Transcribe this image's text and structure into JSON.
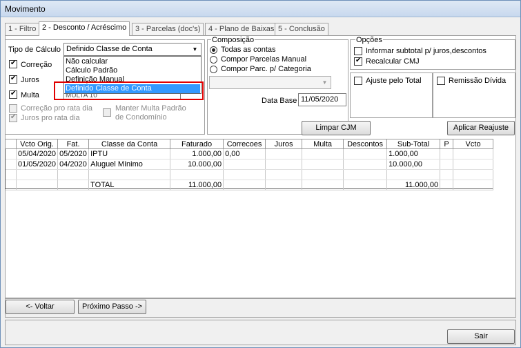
{
  "window": {
    "title": "Movimento"
  },
  "tabs": [
    "1 - Filtro",
    "2 - Desconto / Acréscimo",
    "3 - Parcelas (doc's)",
    "4 - Plano de Baixas",
    "5 - Conclusão"
  ],
  "calc": {
    "label": "Tipo de Cálculo",
    "value": "Definido Classe de Conta",
    "options": [
      "Não calcular",
      "Cálculo Padrão",
      "Definição Manual",
      "Definido Classe de Conta"
    ],
    "hidden_value": "MULTA 10"
  },
  "checks": {
    "correcao": "Correção",
    "juros": "Juros",
    "multa": "Multa",
    "correcao_pro_rata": "Correção pro rata dia",
    "juros_pro_rata": "Juros pro rata dia",
    "manter_multa_1": "Manter Multa Padrão",
    "manter_multa_2": "de Condomínio"
  },
  "composicao": {
    "title": "Composição",
    "options": [
      "Todas as contas",
      "Compor Parcelas Manual",
      "Compor Parc. p/ Categoria"
    ]
  },
  "data_base": {
    "label": "Data Base",
    "value": "11/05/2020"
  },
  "opcoes": {
    "title": "Opções",
    "informar": "Informar subtotal p/ juros,descontos",
    "recalcular": "Recalcular CMJ",
    "ajuste": "Ajuste pelo Total",
    "remissao": "Remissão Dívida"
  },
  "buttons": {
    "limpar": "Limpar CJM",
    "aplicar": "Aplicar Reajuste",
    "voltar": "<- Voltar",
    "proximo": "Próximo Passo ->",
    "sair": "Sair"
  },
  "grid": {
    "headers": [
      "",
      "Vcto Orig.",
      "Fat.",
      "Classe da Conta",
      "Faturado",
      "Correcoes",
      "Juros",
      "Multa",
      "Descontos",
      "Sub-Total",
      "P",
      "Vcto"
    ],
    "rows": [
      [
        "",
        "05/04/2020",
        "05/2020",
        "IPTU",
        "1.000,00",
        "0,00",
        "",
        "",
        "",
        "1.000,00",
        "",
        ""
      ],
      [
        "",
        "01/05/2020",
        "04/2020",
        "Aluguel Mínimo",
        "10.000,00",
        "",
        "",
        "",
        "",
        "10.000,00",
        "",
        ""
      ],
      [
        "",
        "",
        "",
        "",
        "",
        "",
        "",
        "",
        "",
        "",
        "",
        ""
      ],
      [
        "",
        "",
        "",
        "TOTAL",
        "11.000,00",
        "",
        "",
        "",
        "",
        "11.000,00",
        "",
        ""
      ]
    ]
  }
}
